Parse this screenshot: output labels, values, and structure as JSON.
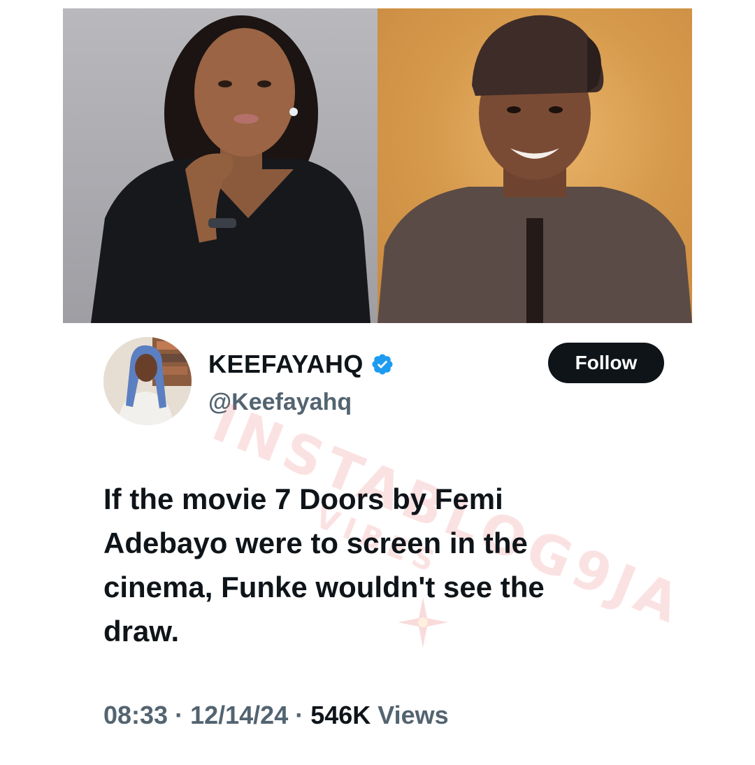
{
  "images": {
    "left_photo": "woman-portrait",
    "right_photo": "man-portrait"
  },
  "author": {
    "display_name": "KEEFAYAHQ",
    "handle": "@Keefayahq",
    "verified_icon": "verified-badge-icon",
    "verified_color": "#1d9bf0",
    "avatar": "profile-avatar"
  },
  "follow_button": {
    "label": "Follow",
    "background": "#0f1419",
    "color": "#ffffff"
  },
  "tweet": {
    "line1": "If the movie 7 Doors by Femi",
    "line2": "Adebayo were to screen in the",
    "line3": "cinema, Funke wouldn't see the",
    "line4": "draw."
  },
  "meta": {
    "time": "08:33",
    "separator": "·",
    "date": "12/14/24",
    "views_count": "546K",
    "views_label": "Views"
  },
  "watermark": {
    "main": "INSTABLOG9JA",
    "sub": "VIBES"
  }
}
